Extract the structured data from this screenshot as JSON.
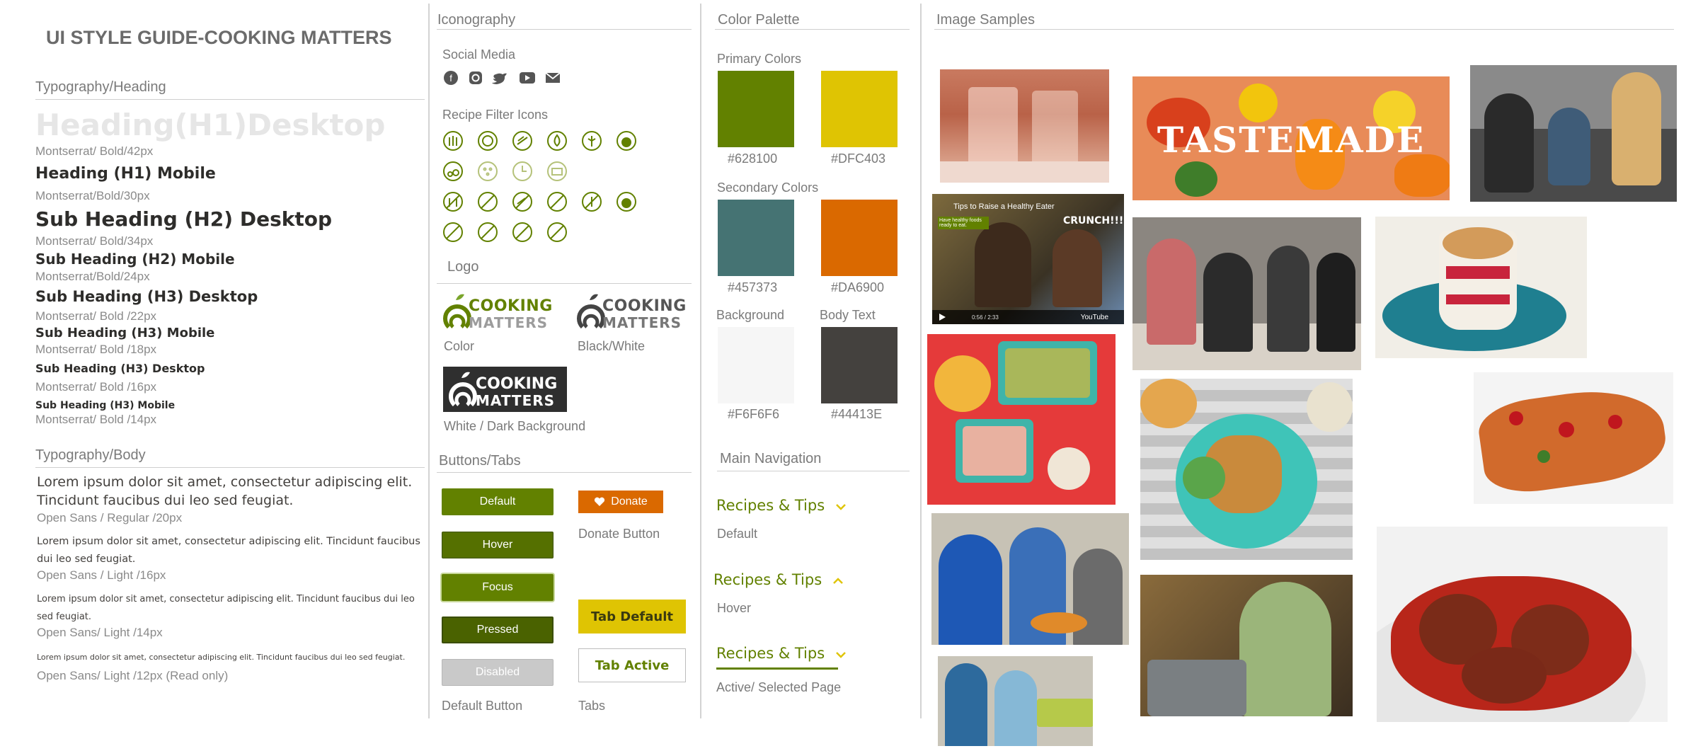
{
  "page_title": "UI STYLE GUIDE-COOKING MATTERS",
  "typography_heading": {
    "title": "Typography/Heading",
    "items": [
      {
        "sample": "Heading(H1)Desktop",
        "spec": "Montserrat/ Bold/42px"
      },
      {
        "sample": "Heading (H1) Mobile",
        "spec": "Montserrat/Bold/30px"
      },
      {
        "sample": "Sub Heading (H2) Desktop",
        "spec": "Montserrat/ Bold/34px"
      },
      {
        "sample": "Sub Heading (H2) Mobile",
        "spec": "Montserrat/Bold/24px"
      },
      {
        "sample": "Sub Heading (H3) Desktop",
        "spec": "Montserrat/ Bold /22px"
      },
      {
        "sample": "Sub Heading (H3) Mobile",
        "spec": "Montserrat/ Bold /18px"
      },
      {
        "sample": "Sub Heading (H3) Desktop",
        "spec": "Montserrat/ Bold /16px"
      },
      {
        "sample": "Sub Heading (H3) Mobile",
        "spec": "Montserrat/ Bold /14px"
      }
    ]
  },
  "typography_body": {
    "title": "Typography/Body",
    "items": [
      {
        "sample": "Lorem ipsum dolor sit amet, consectetur adipiscing elit. Tincidunt faucibus dui leo sed feugiat.",
        "spec": "Open Sans / Regular /20px"
      },
      {
        "sample": "Lorem ipsum dolor sit amet, consectetur adipiscing elit. Tincidunt faucibus dui leo sed feugiat.",
        "spec": "Open Sans / Light /16px"
      },
      {
        "sample": "Lorem ipsum dolor sit amet, consectetur adipiscing elit. Tincidunt faucibus dui leo sed feugiat.",
        "spec": "Open Sans/ Light /14px"
      },
      {
        "sample": "Lorem ipsum dolor sit amet, consectetur adipiscing elit. Tincidunt faucibus dui leo sed feugiat.",
        "spec": "Open Sans/ Light /12px (Read only)"
      }
    ]
  },
  "iconography": {
    "title": "Iconography",
    "social_title": "Social Media",
    "social_icons": [
      "facebook-icon",
      "instagram-icon",
      "twitter-icon",
      "youtube-icon",
      "email-icon"
    ],
    "filter_title": "Recipe Filter Icons"
  },
  "logo": {
    "title": "Logo",
    "wordmark_line1": "COOKING",
    "wordmark_line2": "MATTERS",
    "color_label": "Color",
    "bw_label": "Black/White",
    "dark_label": "White / Dark Background"
  },
  "buttons": {
    "title": "Buttons/Tabs",
    "default": "Default",
    "hover": "Hover",
    "focus": "Focus",
    "pressed": "Pressed",
    "disabled": "Disabled",
    "default_caption": "Default Button",
    "donate": "Donate",
    "donate_caption": "Donate Button",
    "tab_default": "Tab Default",
    "tab_active": "Tab Active",
    "tabs_caption": "Tabs"
  },
  "palette": {
    "title": "Color Palette",
    "primary_title": "Primary Colors",
    "secondary_title": "Secondary Colors",
    "background_title": "Background",
    "body_text_title": "Body Text",
    "primary": [
      "#628100",
      "#DFC403"
    ],
    "secondary": [
      "#457373",
      "#DA6900"
    ],
    "background": "#F6F6F6",
    "body_text": "#44413E"
  },
  "navigation": {
    "title": "Main Navigation",
    "link_label": "Recipes & Tips",
    "default_caption": "Default",
    "hover_caption": "Hover",
    "active_caption": "Active/ Selected Page"
  },
  "images": {
    "title": "Image Samples",
    "tastemade_text": "TASTEMADE",
    "video_title": "Tips to Raise a Healthy Eater",
    "video_overlay": "CRUNCH!!!",
    "video_badge": "Have healthy foods ready to eat.",
    "video_time": "0:56 / 2:33",
    "video_brand": "YouTube"
  }
}
